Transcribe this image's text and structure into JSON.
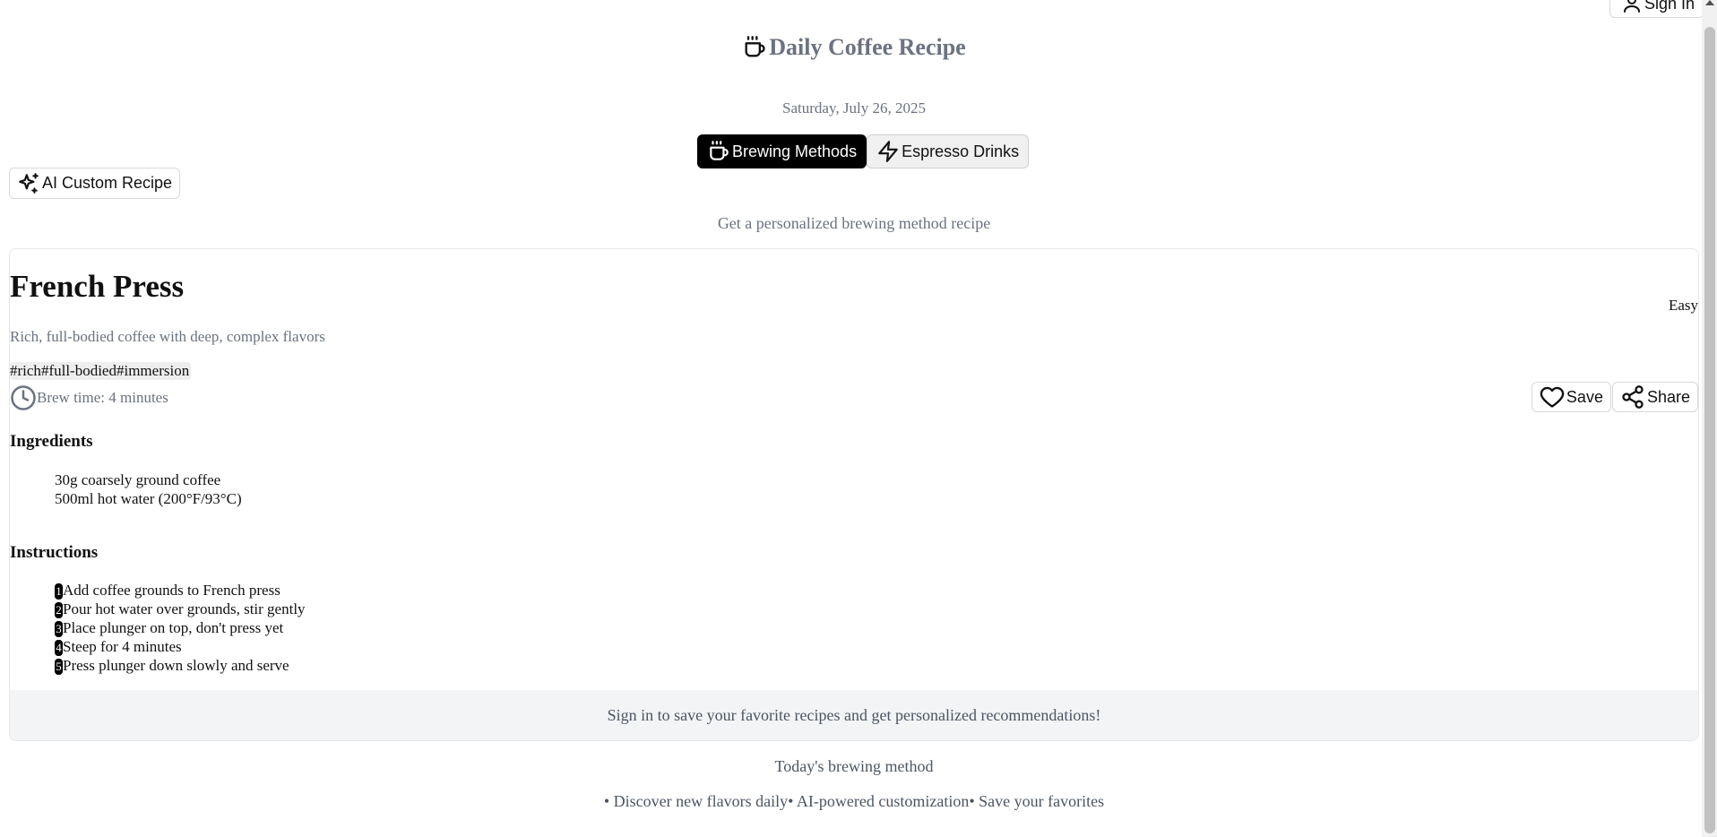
{
  "header": {
    "signin_label": "Sign In",
    "title": "Daily Coffee Recipe",
    "date": "Saturday, July 26, 2025"
  },
  "tabs": [
    {
      "label": "Brewing Methods",
      "icon": "coffee-cup-icon",
      "active": true
    },
    {
      "label": "Espresso Drinks",
      "icon": "lightning-icon",
      "active": false
    }
  ],
  "ai_button": {
    "label": "AI Custom Recipe",
    "icon": "sparkles-icon"
  },
  "subtitle": "Get a personalized brewing method recipe",
  "recipe": {
    "name": "French Press",
    "difficulty": "Easy",
    "description": "Rich, full-bodied coffee with deep, complex flavors",
    "tags": [
      "#rich",
      "#full-bodied",
      "#immersion"
    ],
    "brew_time": "Brew time: 4 minutes",
    "save_label": "Save",
    "share_label": "Share",
    "ingredients_heading": "Ingredients",
    "ingredients": [
      "30g coarsely ground coffee",
      "500ml hot water (200°F/93°C)"
    ],
    "instructions_heading": "Instructions",
    "instructions": [
      {
        "num": "1",
        "text": "Add coffee grounds to French press"
      },
      {
        "num": "2",
        "text": "Pour hot water over grounds, stir gently"
      },
      {
        "num": "3",
        "text": "Place plunger on top, don't press yet"
      },
      {
        "num": "4",
        "text": "Steep for 4 minutes"
      },
      {
        "num": "5",
        "text": "Press plunger down slowly and serve"
      }
    ],
    "signin_prompt": "Sign in to save your favorite recipes and get personalized recommendations!"
  },
  "footer": {
    "today_label": "Today's brewing method",
    "features": [
      "• Discover new flavors daily",
      "• AI-powered customization",
      "• Save your favorites"
    ]
  },
  "colors": {
    "muted_text": "#6b7280",
    "active_tab_bg": "#000000",
    "banner_bg": "#f3f4f6"
  }
}
